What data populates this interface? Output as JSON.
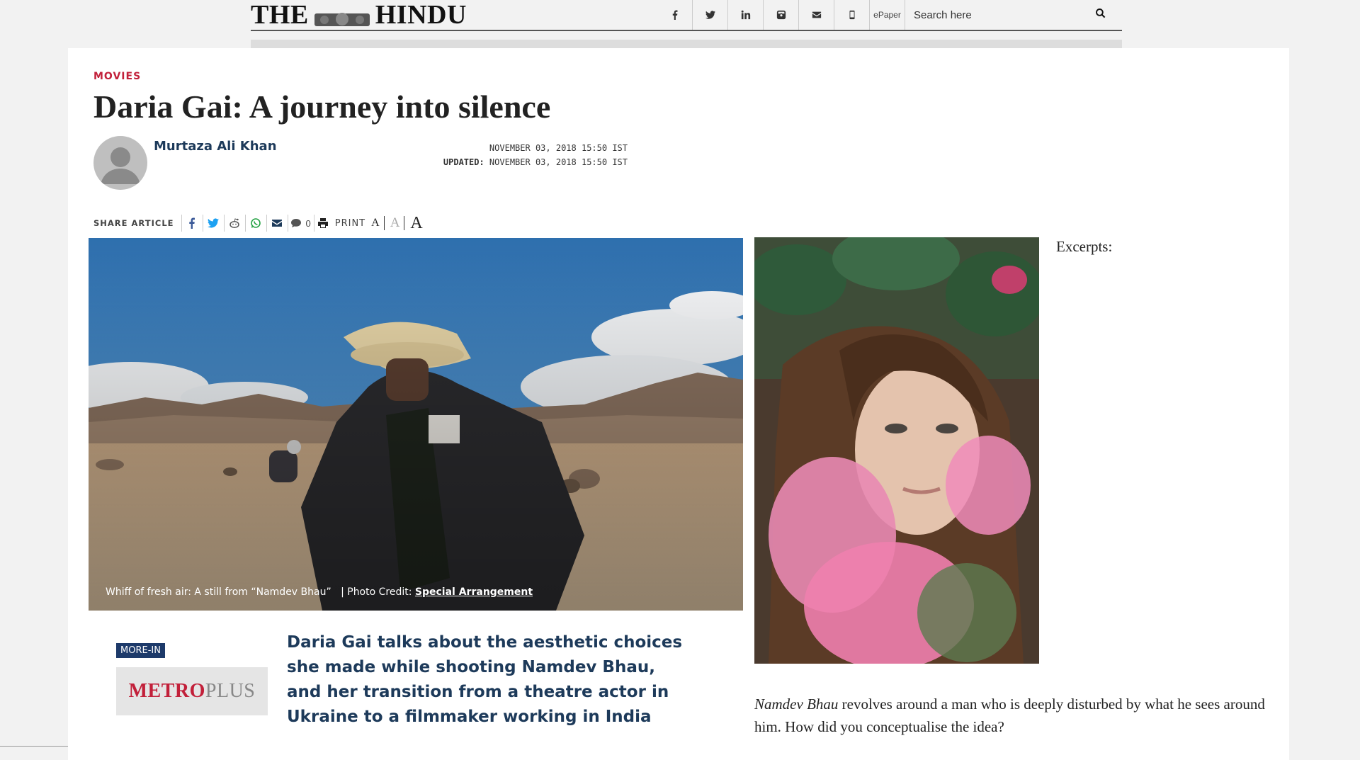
{
  "header": {
    "logo_left": "THE",
    "logo_right": "HINDU",
    "epaper": "ePaper",
    "search_placeholder": "Search here",
    "icons": [
      "facebook-icon",
      "twitter-icon",
      "linkedin-icon",
      "instagram-icon",
      "mail-icon",
      "mobile-icon"
    ]
  },
  "article": {
    "section": "MOVIES",
    "headline": "Daria Gai: A journey into silence",
    "author": "Murtaza Ali Khan",
    "published": "NOVEMBER 03, 2018 15:50 IST",
    "updated_label": "UPDATED:",
    "updated": "NOVEMBER 03, 2018 15:50 IST",
    "share_label": "SHARE ARTICLE",
    "comment_count": "0",
    "print_label": "PRINT",
    "font_sizes": [
      "A",
      "A",
      "A"
    ],
    "caption_text": "Whiff of fresh air: A still from “Namdev Bhau”",
    "caption_credit_label": "| Photo Credit:",
    "caption_credit": "Special Arrangement",
    "excerpts": "Excerpts:",
    "more_in": "MORE-IN",
    "metro": "METRO",
    "plus": "PLUS",
    "lede": "Daria Gai talks about the aesthetic choices she made while shooting Namdev Bhau, and her transition from a theatre actor in Ukraine to a filmmaker working in India",
    "question_title": "Namdev Bhau",
    "question_rest": " revolves around a man who is deeply disturbed by what he sees around him. How did you conceptualise the idea?"
  },
  "colors": {
    "accent_red": "#c2203a",
    "navy": "#1d3a5a",
    "badge": "#1d3a6a"
  }
}
